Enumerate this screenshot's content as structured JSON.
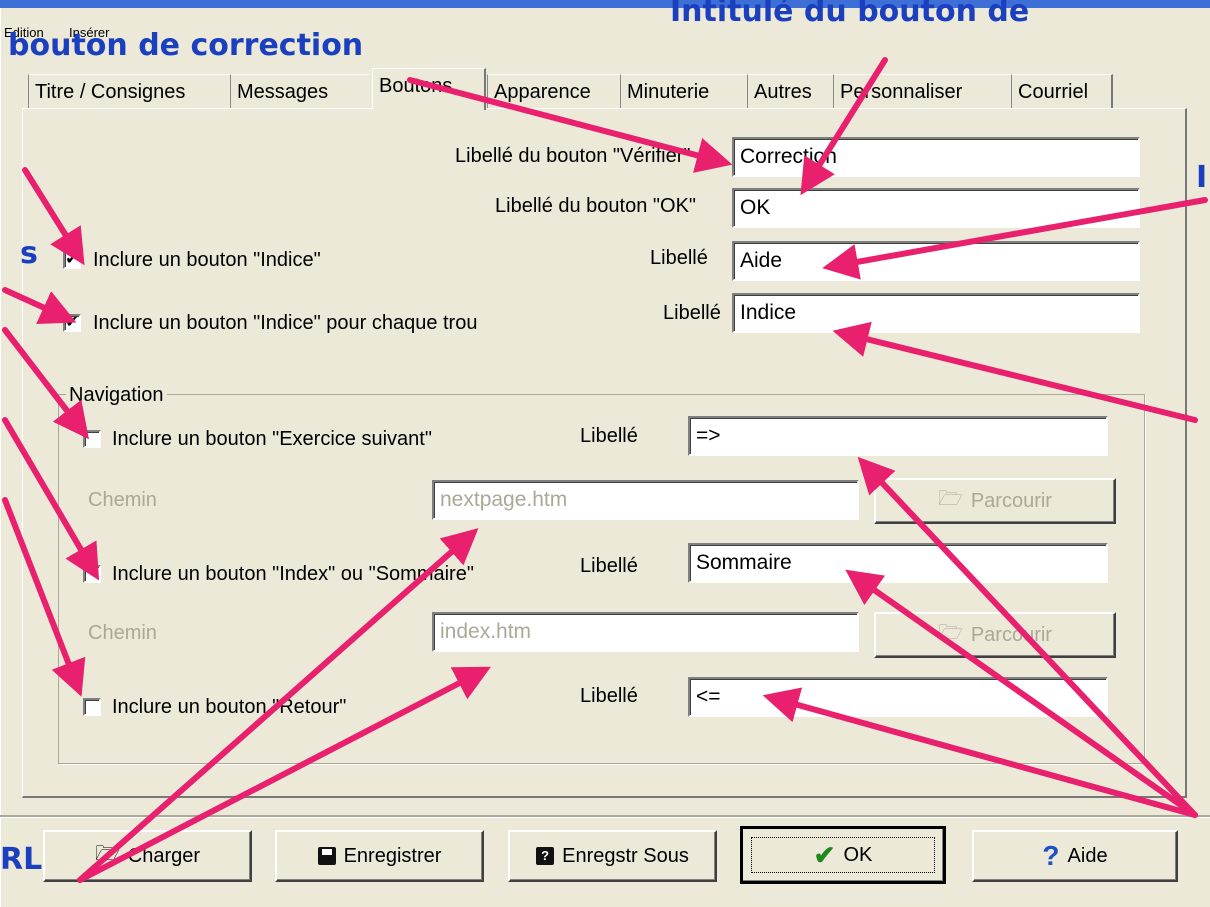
{
  "menu": {
    "edit": "Edition",
    "insert": "Insérer"
  },
  "annotations": {
    "top_right": "Intitulé du bouton de",
    "top_left": "bouton de correction",
    "left_a": "s",
    "right_i": "I",
    "bottom_left": "RL"
  },
  "tabs": [
    "Titre / Consignes",
    "Messages",
    "Boutons",
    "Apparence",
    "Minuterie",
    "Autres",
    "Personnaliser",
    "Courriel"
  ],
  "fields": {
    "verifier_label": "Libellé du bouton \"Vérifier\"",
    "verifier_value": "Correction",
    "ok_label": "Libellé du bouton \"OK\"",
    "ok_value": "OK",
    "hint_check": "Inclure un bouton \"Indice\"",
    "hint_label": "Libellé",
    "hint_value": "Aide",
    "hint_each_check": "Inclure un bouton \"Indice\" pour chaque trou",
    "hint_each_label": "Libellé",
    "hint_each_value": "Indice"
  },
  "navigation": {
    "title": "Navigation",
    "next_check": "Inclure un bouton \"Exercice suivant\"",
    "next_label": "Libellé",
    "next_value": "=>",
    "next_path_label": "Chemin",
    "next_path_value": "nextpage.htm",
    "browse": "Parcourir",
    "index_check": "Inclure un bouton \"Index\" ou \"Sommaire\"",
    "index_label": "Libellé",
    "index_value": "Sommaire",
    "index_path_label": "Chemin",
    "index_path_value": "index.htm",
    "back_check": "Inclure un bouton \"Retour\"",
    "back_label": "Libellé",
    "back_value": "<="
  },
  "buttons": {
    "load": "Charger",
    "save": "Enregistrer",
    "save_as": "Enregstr Sous",
    "ok": "OK",
    "help": "Aide"
  },
  "colors": {
    "annotation": "#1a3fbf",
    "arrow": "#e8206e",
    "window": "#ece9d8"
  }
}
